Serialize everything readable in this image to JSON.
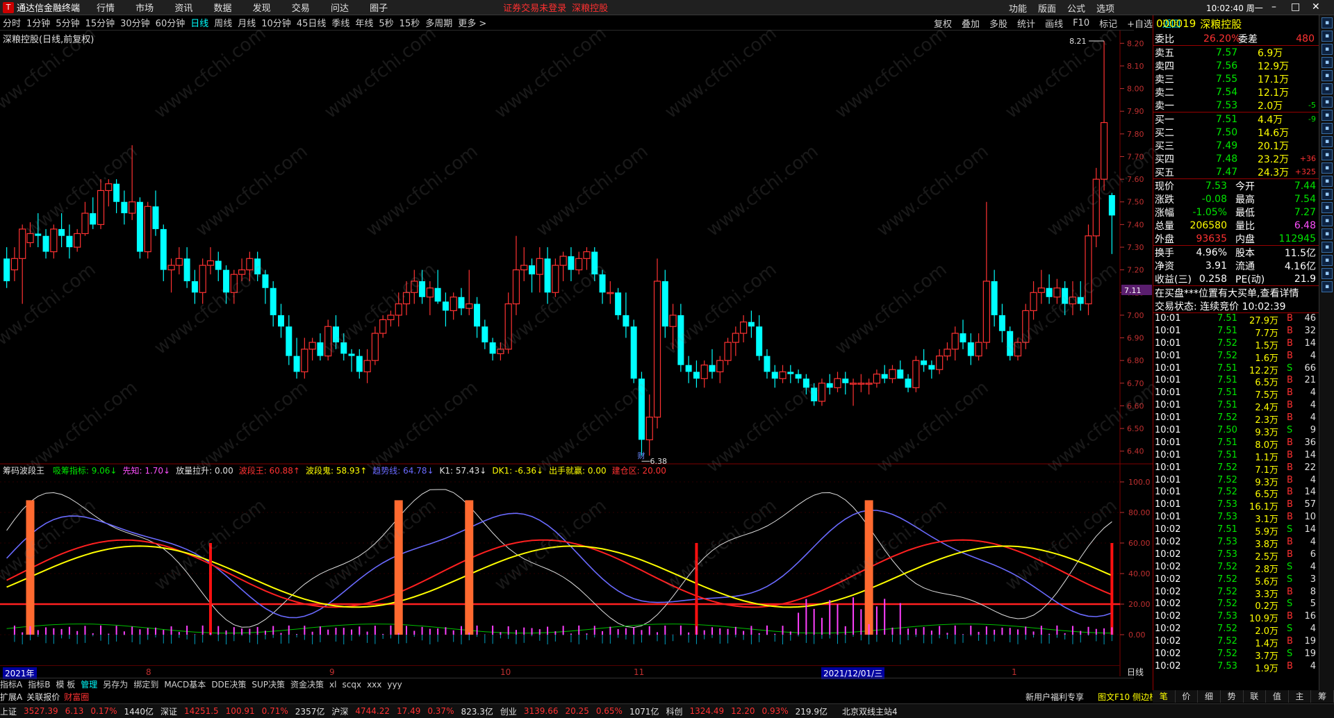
{
  "titlebar": {
    "app": "通达信金融终端",
    "menu": [
      "行情",
      "市场",
      "资讯",
      "数据",
      "发现",
      "交易",
      "问达",
      "圈子"
    ],
    "notice": "证券交易未登录",
    "notice2": "深粮控股",
    "right_menu": [
      "功能",
      "版面",
      "公式",
      "选项"
    ],
    "clock": "10:02:40 周一"
  },
  "periods": [
    "分时",
    "1分钟",
    "5分钟",
    "15分钟",
    "30分钟",
    "60分钟",
    "日线",
    "周线",
    "月线",
    "10分钟",
    "45日线",
    "季线",
    "年线",
    "5秒",
    "15秒",
    "多周期",
    "更多 >"
  ],
  "active_period": "日线",
  "tools": [
    "复权",
    "叠加",
    "多股",
    "统计",
    "画线",
    "F10",
    "标记",
    "+自选",
    "返回"
  ],
  "main_title": "深粮控股(日线,前复权)",
  "watermark": "www.cfchi.com",
  "price_axis": [
    "8.20",
    "8.10",
    "8.00",
    "7.90",
    "7.80",
    "7.70",
    "7.60",
    "7.50",
    "7.40",
    "7.30",
    "7.20",
    "7.10",
    "7.00",
    "6.90",
    "6.80",
    "6.70",
    "6.60",
    "6.50",
    "6.40"
  ],
  "price_marker": "7.11",
  "high_label": "8.21",
  "low_label": "6.38",
  "cai_label": "财",
  "indicator": {
    "name": "筹码波段王",
    "items": [
      {
        "label": "吸筹指标: 9.06↓",
        "color": "#00e600"
      },
      {
        "label": "先知: 1.70↓",
        "color": "#ff50ff"
      },
      {
        "label": "放量拉升: 0.00",
        "color": "#e0e0e0"
      },
      {
        "label": "波段王: 60.88↑",
        "color": "#ff3232"
      },
      {
        "label": "波段鬼: 58.93↑",
        "color": "#ffff00"
      },
      {
        "label": "趋势线: 64.78↓",
        "color": "#6a6aff"
      },
      {
        "label": "K1: 57.43↓",
        "color": "#e0e0e0"
      },
      {
        "label": "DK1: -6.36↓",
        "color": "#ffff00"
      },
      {
        "label": "出手就赢: 0.00",
        "color": "#ffff00"
      },
      {
        "label": "建仓区: 20.00",
        "color": "#ff3232"
      }
    ]
  },
  "ind_axis": [
    "100.0",
    "80.00",
    "60.00",
    "40.00",
    "20.00",
    "0.00"
  ],
  "xaxis": [
    {
      "t": "2021年",
      "x": 4
    },
    {
      "t": "8",
      "x": 210
    },
    {
      "t": "9",
      "x": 474
    },
    {
      "t": "10",
      "x": 720
    },
    {
      "t": "11",
      "x": 912
    },
    {
      "t": "2021/12/01/三",
      "x": 1182
    },
    {
      "t": "1",
      "x": 1456
    }
  ],
  "xaxis_right": "日线",
  "tabs": [
    "指标A",
    "指标B",
    "模 板",
    "管理",
    "另存为",
    "绑定到",
    "MACD基本",
    "DDE决策",
    "SUP决策",
    "资金决策",
    "xl",
    "scqx",
    "xxx",
    "yyy"
  ],
  "active_tab": "管理",
  "bottom2": [
    "扩展A",
    "关联报价",
    "财富圈"
  ],
  "bottom2_right": "新用户福利专享",
  "bottom2_right2": "图文F10 侧边栏《",
  "status": [
    {
      "n": "上证",
      "v": "3527.39",
      "c": "6.13",
      "p": "0.17%",
      "a": "1440亿"
    },
    {
      "n": "深证",
      "v": "14251.5",
      "c": "100.91",
      "p": "0.71%",
      "a": "2357亿"
    },
    {
      "n": "沪深",
      "v": "4744.22",
      "c": "17.49",
      "p": "0.37%",
      "a": "823.3亿"
    },
    {
      "n": "创业",
      "v": "3139.66",
      "c": "20.25",
      "p": "0.65%",
      "a": "1071亿"
    },
    {
      "n": "科创",
      "v": "1324.49",
      "c": "12.20",
      "p": "0.93%",
      "a": "219.9亿"
    }
  ],
  "status_site": "北京双线主站4",
  "stock": {
    "code": "000019",
    "name": "深粮控股",
    "weibi_label": "委比",
    "weibi": "26.20%",
    "weicha_label": "委差",
    "weicha": "480"
  },
  "asks": [
    {
      "l": "卖五",
      "p": "7.57",
      "v": "6.9万",
      "d": ""
    },
    {
      "l": "卖四",
      "p": "7.56",
      "v": "12.9万",
      "d": ""
    },
    {
      "l": "卖三",
      "p": "7.55",
      "v": "17.1万",
      "d": ""
    },
    {
      "l": "卖二",
      "p": "7.54",
      "v": "12.1万",
      "d": ""
    },
    {
      "l": "卖一",
      "p": "7.53",
      "v": "2.0万",
      "d": "-5"
    }
  ],
  "bids": [
    {
      "l": "买一",
      "p": "7.51",
      "v": "4.4万",
      "d": "-9"
    },
    {
      "l": "买二",
      "p": "7.50",
      "v": "14.6万",
      "d": ""
    },
    {
      "l": "买三",
      "p": "7.49",
      "v": "20.1万",
      "d": ""
    },
    {
      "l": "买四",
      "p": "7.48",
      "v": "23.2万",
      "d": "+36"
    },
    {
      "l": "买五",
      "p": "7.47",
      "v": "24.3万",
      "d": "+325"
    }
  ],
  "quote": [
    {
      "l1": "现价",
      "v1": "7.53",
      "l2": "今开",
      "v2": "7.44",
      "c1": "#00e600",
      "c2": "#00e600"
    },
    {
      "l1": "涨跌",
      "v1": "-0.08",
      "l2": "最高",
      "v2": "7.54",
      "c1": "#00e600",
      "c2": "#00e600"
    },
    {
      "l1": "涨幅",
      "v1": "-1.05%",
      "l2": "最低",
      "v2": "7.27",
      "c1": "#00e600",
      "c2": "#00e600"
    },
    {
      "l1": "总量",
      "v1": "206580",
      "l2": "量比",
      "v2": "6.48",
      "c1": "#ffff00",
      "c2": "#ff50ff"
    },
    {
      "l1": "外盘",
      "v1": "93635",
      "l2": "内盘",
      "v2": "112945",
      "c1": "#ff3232",
      "c2": "#00e600"
    },
    {
      "l1": "换手",
      "v1": "4.96%",
      "l2": "股本",
      "v2": "11.5亿",
      "c1": "#ffffff",
      "c2": "#ffffff"
    },
    {
      "l1": "净资",
      "v1": "3.91",
      "l2": "流通",
      "v2": "4.16亿",
      "c1": "#ffffff",
      "c2": "#ffffff"
    },
    {
      "l1": "收益(三)",
      "v1": "0.258",
      "l2": "PE(动)",
      "v2": "21.9",
      "c1": "#ffffff",
      "c2": "#ffffff"
    }
  ],
  "notice_line": "在买盘***位置有大买单,查看详情",
  "trade_status": "交易状态: 连续竞价 10:02:39",
  "ticks": [
    {
      "t": "10:01",
      "p": "7.51",
      "v": "27.9万",
      "s": "B",
      "n": "46"
    },
    {
      "t": "10:01",
      "p": "7.51",
      "v": "7.7万",
      "s": "B",
      "n": "32"
    },
    {
      "t": "10:01",
      "p": "7.52",
      "v": "1.5万",
      "s": "B",
      "n": "14"
    },
    {
      "t": "10:01",
      "p": "7.52",
      "v": "1.6万",
      "s": "B",
      "n": "4"
    },
    {
      "t": "10:01",
      "p": "7.51",
      "v": "12.2万",
      "s": "S",
      "n": "66"
    },
    {
      "t": "10:01",
      "p": "7.51",
      "v": "6.5万",
      "s": "B",
      "n": "21"
    },
    {
      "t": "10:01",
      "p": "7.51",
      "v": "7.5万",
      "s": "B",
      "n": "4"
    },
    {
      "t": "10:01",
      "p": "7.51",
      "v": "2.4万",
      "s": "B",
      "n": "4"
    },
    {
      "t": "10:01",
      "p": "7.52",
      "v": "2.3万",
      "s": "B",
      "n": "4"
    },
    {
      "t": "10:01",
      "p": "7.50",
      "v": "9.3万",
      "s": "S",
      "n": "9"
    },
    {
      "t": "10:01",
      "p": "7.51",
      "v": "8.0万",
      "s": "B",
      "n": "36"
    },
    {
      "t": "10:01",
      "p": "7.51",
      "v": "1.1万",
      "s": "B",
      "n": "14"
    },
    {
      "t": "10:01",
      "p": "7.52",
      "v": "7.1万",
      "s": "B",
      "n": "22"
    },
    {
      "t": "10:01",
      "p": "7.52",
      "v": "9.3万",
      "s": "B",
      "n": "4"
    },
    {
      "t": "10:01",
      "p": "7.52",
      "v": "6.5万",
      "s": "B",
      "n": "14"
    },
    {
      "t": "10:01",
      "p": "7.53",
      "v": "16.1万",
      "s": "B",
      "n": "57"
    },
    {
      "t": "10:01",
      "p": "7.53",
      "v": "3.1万",
      "s": "B",
      "n": "10"
    },
    {
      "t": "10:02",
      "p": "7.51",
      "v": "5.9万",
      "s": "S",
      "n": "14"
    },
    {
      "t": "10:02",
      "p": "7.53",
      "v": "3.8万",
      "s": "B",
      "n": "4"
    },
    {
      "t": "10:02",
      "p": "7.53",
      "v": "2.5万",
      "s": "B",
      "n": "6"
    },
    {
      "t": "10:02",
      "p": "7.52",
      "v": "2.8万",
      "s": "S",
      "n": "4"
    },
    {
      "t": "10:02",
      "p": "7.52",
      "v": "5.6万",
      "s": "S",
      "n": "3"
    },
    {
      "t": "10:02",
      "p": "7.52",
      "v": "3.3万",
      "s": "B",
      "n": "8"
    },
    {
      "t": "10:02",
      "p": "7.52",
      "v": "0.2万",
      "s": "S",
      "n": "5"
    },
    {
      "t": "10:02",
      "p": "7.53",
      "v": "10.9万",
      "s": "B",
      "n": "16"
    },
    {
      "t": "10:02",
      "p": "7.52",
      "v": "2.0万",
      "s": "S",
      "n": "4"
    },
    {
      "t": "10:02",
      "p": "7.52",
      "v": "1.4万",
      "s": "B",
      "n": "19"
    },
    {
      "t": "10:02",
      "p": "7.52",
      "v": "3.7万",
      "s": "S",
      "n": "19"
    },
    {
      "t": "10:02",
      "p": "7.53",
      "v": "1.9万",
      "s": "B",
      "n": "4"
    }
  ],
  "rpanel_bottom": [
    "笔",
    "价",
    "细",
    "势",
    "联",
    "值",
    "主",
    "筹"
  ],
  "colors": {
    "up": "#ff3232",
    "down": "#00ffff",
    "bg": "#000000",
    "grid": "#5a0000",
    "axis": "#c03030"
  },
  "chart_data": {
    "type": "candlestick",
    "ohlc": [
      [
        7.25,
        7.3,
        7.12,
        7.15
      ],
      [
        7.2,
        7.3,
        7.15,
        7.25
      ],
      [
        7.25,
        7.4,
        7.05,
        7.38
      ],
      [
        7.32,
        7.41,
        7.3,
        7.36
      ],
      [
        7.36,
        7.45,
        7.3,
        7.35
      ],
      [
        7.35,
        7.38,
        7.25,
        7.28
      ],
      [
        7.28,
        7.4,
        7.25,
        7.38
      ],
      [
        7.38,
        7.45,
        7.3,
        7.35
      ],
      [
        7.35,
        7.4,
        7.25,
        7.3
      ],
      [
        7.3,
        7.38,
        7.28,
        7.36
      ],
      [
        7.36,
        7.5,
        7.35,
        7.45
      ],
      [
        7.45,
        7.52,
        7.38,
        7.4
      ],
      [
        7.4,
        7.6,
        7.38,
        7.55
      ],
      [
        7.55,
        7.6,
        7.48,
        7.58
      ],
      [
        7.58,
        7.6,
        7.45,
        7.5
      ],
      [
        7.5,
        7.55,
        7.4,
        7.45
      ],
      [
        7.45,
        7.75,
        7.42,
        7.5
      ],
      [
        7.5,
        7.52,
        7.25,
        7.28
      ],
      [
        7.28,
        7.5,
        7.25,
        7.48
      ],
      [
        7.48,
        7.55,
        7.35,
        7.38
      ],
      [
        7.38,
        7.4,
        7.15,
        7.2
      ],
      [
        7.2,
        7.25,
        7.1,
        7.22
      ],
      [
        7.22,
        7.3,
        7.18,
        7.25
      ],
      [
        7.25,
        7.3,
        7.12,
        7.15
      ],
      [
        7.15,
        7.2,
        7.05,
        7.1
      ],
      [
        7.1,
        7.25,
        7.05,
        7.22
      ],
      [
        7.22,
        7.3,
        7.18,
        7.24
      ],
      [
        7.24,
        7.28,
        7.15,
        7.2
      ],
      [
        7.2,
        7.22,
        7.05,
        7.1
      ],
      [
        7.1,
        7.2,
        7.05,
        7.18
      ],
      [
        7.18,
        7.25,
        7.15,
        7.2
      ],
      [
        7.2,
        7.28,
        7.15,
        7.25
      ],
      [
        7.25,
        7.28,
        7.15,
        7.18
      ],
      [
        7.18,
        7.2,
        7.05,
        7.12
      ],
      [
        7.12,
        7.15,
        6.95,
        7.0
      ],
      [
        7.0,
        7.05,
        6.9,
        6.95
      ],
      [
        6.95,
        7.0,
        6.78,
        6.82
      ],
      [
        6.82,
        6.9,
        6.72,
        6.75
      ],
      [
        6.75,
        6.9,
        6.72,
        6.85
      ],
      [
        6.85,
        6.9,
        6.8,
        6.88
      ],
      [
        6.88,
        6.92,
        6.8,
        6.82
      ],
      [
        6.82,
        6.98,
        6.8,
        6.95
      ],
      [
        6.95,
        7.0,
        6.85,
        6.88
      ],
      [
        6.88,
        6.92,
        6.8,
        6.83
      ],
      [
        6.83,
        6.85,
        6.75,
        6.82
      ],
      [
        6.82,
        6.85,
        6.72,
        6.75
      ],
      [
        6.75,
        6.85,
        6.7,
        6.8
      ],
      [
        6.8,
        6.95,
        6.78,
        6.92
      ],
      [
        6.92,
        7.0,
        6.9,
        6.98
      ],
      [
        6.98,
        7.02,
        6.95,
        7.0
      ],
      [
        7.0,
        7.1,
        6.95,
        7.05
      ],
      [
        7.05,
        7.15,
        7.0,
        7.1
      ],
      [
        7.1,
        7.2,
        7.05,
        7.15
      ],
      [
        7.15,
        7.2,
        7.05,
        7.08
      ],
      [
        7.08,
        7.15,
        7.0,
        7.12
      ],
      [
        7.12,
        7.2,
        7.05,
        7.06
      ],
      [
        7.06,
        7.1,
        6.95,
        7.02
      ],
      [
        7.02,
        7.1,
        6.98,
        7.08
      ],
      [
        7.08,
        7.12,
        7.0,
        7.03
      ],
      [
        7.03,
        7.2,
        7.0,
        7.05
      ],
      [
        7.05,
        7.08,
        6.9,
        6.95
      ],
      [
        6.95,
        6.98,
        6.85,
        6.88
      ],
      [
        6.88,
        6.9,
        6.8,
        6.83
      ],
      [
        6.83,
        6.88,
        6.8,
        6.85
      ],
      [
        6.85,
        7.1,
        6.83,
        7.05
      ],
      [
        7.05,
        7.35,
        7.0,
        7.2
      ],
      [
        7.2,
        7.3,
        7.15,
        7.22
      ],
      [
        7.22,
        7.25,
        7.1,
        7.18
      ],
      [
        7.18,
        7.3,
        7.1,
        7.25
      ],
      [
        7.25,
        7.3,
        7.05,
        7.1
      ],
      [
        7.1,
        7.25,
        7.08,
        7.22
      ],
      [
        7.22,
        7.28,
        7.15,
        7.26
      ],
      [
        7.26,
        7.3,
        7.15,
        7.2
      ],
      [
        7.2,
        7.28,
        7.18,
        7.25
      ],
      [
        7.25,
        7.3,
        7.2,
        7.28
      ],
      [
        7.28,
        7.3,
        7.15,
        7.18
      ],
      [
        7.18,
        7.2,
        7.05,
        7.1
      ],
      [
        7.1,
        7.15,
        7.05,
        7.1
      ],
      [
        7.1,
        7.12,
        6.98,
        7.0
      ],
      [
        7.0,
        7.1,
        6.9,
        6.95
      ],
      [
        6.95,
        6.98,
        6.7,
        6.72
      ],
      [
        6.72,
        6.75,
        6.38,
        6.45
      ],
      [
        6.45,
        6.65,
        6.38,
        6.55
      ],
      [
        6.55,
        7.25,
        6.5,
        7.15
      ],
      [
        7.15,
        7.2,
        6.9,
        6.95
      ],
      [
        6.95,
        7.05,
        6.85,
        7.0
      ],
      [
        7.0,
        7.05,
        6.75,
        6.78
      ],
      [
        6.78,
        6.82,
        6.7,
        6.75
      ],
      [
        6.75,
        6.8,
        6.68,
        6.72
      ],
      [
        6.72,
        6.8,
        6.68,
        6.78
      ],
      [
        6.78,
        6.85,
        6.72,
        6.75
      ],
      [
        6.75,
        6.82,
        6.7,
        6.8
      ],
      [
        6.8,
        6.9,
        6.78,
        6.88
      ],
      [
        6.88,
        6.95,
        6.82,
        6.92
      ],
      [
        6.92,
        7.0,
        6.88,
        6.97
      ],
      [
        6.97,
        7.02,
        6.9,
        6.95
      ],
      [
        6.95,
        7.0,
        6.8,
        6.82
      ],
      [
        6.82,
        6.85,
        6.72,
        6.75
      ],
      [
        6.75,
        6.78,
        6.68,
        6.72
      ],
      [
        6.72,
        6.78,
        6.7,
        6.75
      ],
      [
        6.75,
        6.78,
        6.7,
        6.74
      ],
      [
        6.74,
        6.76,
        6.7,
        6.72
      ],
      [
        6.72,
        6.74,
        6.65,
        6.68
      ],
      [
        6.68,
        6.7,
        6.6,
        6.62
      ],
      [
        6.62,
        6.72,
        6.6,
        6.7
      ],
      [
        6.7,
        6.74,
        6.65,
        6.68
      ],
      [
        6.68,
        6.75,
        6.66,
        6.72
      ],
      [
        6.72,
        6.75,
        6.65,
        6.7
      ],
      [
        6.7,
        6.72,
        6.6,
        6.7
      ],
      [
        6.7,
        6.74,
        6.66,
        6.7
      ],
      [
        6.7,
        6.72,
        6.65,
        6.7
      ],
      [
        6.7,
        6.76,
        6.68,
        6.74
      ],
      [
        6.74,
        6.78,
        6.7,
        6.72
      ],
      [
        6.72,
        6.78,
        6.7,
        6.76
      ],
      [
        6.76,
        6.8,
        6.72,
        6.72
      ],
      [
        6.72,
        6.74,
        6.66,
        6.68
      ],
      [
        6.68,
        6.82,
        6.66,
        6.8
      ],
      [
        6.8,
        6.85,
        6.75,
        6.78
      ],
      [
        6.78,
        6.8,
        6.72,
        6.76
      ],
      [
        6.76,
        6.85,
        6.74,
        6.82
      ],
      [
        6.82,
        6.88,
        6.8,
        6.85
      ],
      [
        6.85,
        6.95,
        6.8,
        6.92
      ],
      [
        6.92,
        6.98,
        6.85,
        6.88
      ],
      [
        6.88,
        6.92,
        6.78,
        6.82
      ],
      [
        6.82,
        6.92,
        6.8,
        6.88
      ],
      [
        6.88,
        7.5,
        6.85,
        7.15
      ],
      [
        7.15,
        7.2,
        6.95,
        7.0
      ],
      [
        7.0,
        7.05,
        6.88,
        6.93
      ],
      [
        6.93,
        6.95,
        6.8,
        6.82
      ],
      [
        6.82,
        6.9,
        6.8,
        6.88
      ],
      [
        6.88,
        7.05,
        6.85,
        7.02
      ],
      [
        7.02,
        7.15,
        6.98,
        7.1
      ],
      [
        7.1,
        7.2,
        7.05,
        7.12
      ],
      [
        7.12,
        7.18,
        7.05,
        7.08
      ],
      [
        7.08,
        7.16,
        7.05,
        7.12
      ],
      [
        7.12,
        7.15,
        7.0,
        7.05
      ],
      [
        7.05,
        7.15,
        7.0,
        7.08
      ],
      [
        7.08,
        7.15,
        7.02,
        7.05
      ],
      [
        7.05,
        7.4,
        7.0,
        7.35
      ],
      [
        7.35,
        7.65,
        7.3,
        7.6
      ],
      [
        7.6,
        8.21,
        7.55,
        7.85
      ],
      [
        7.53,
        7.54,
        7.27,
        7.44
      ]
    ],
    "y_range": [
      6.35,
      8.25
    ]
  }
}
